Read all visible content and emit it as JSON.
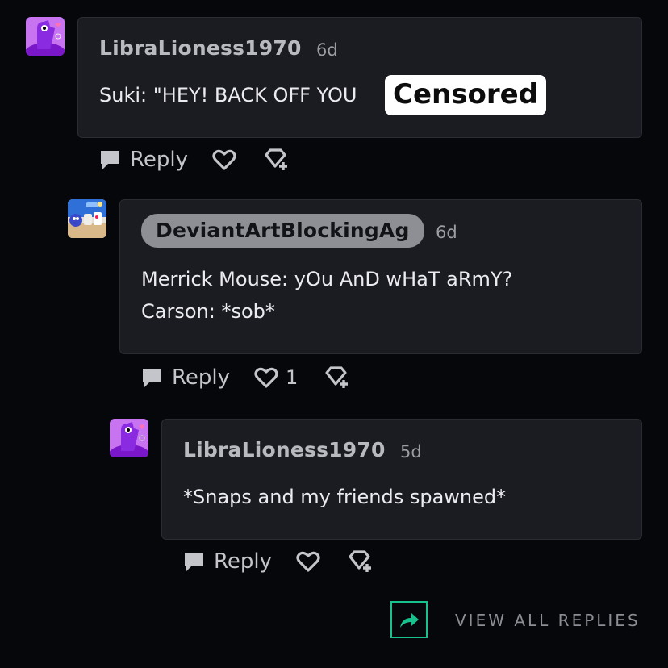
{
  "comments": [
    {
      "username": "LibraLioness1970",
      "time": "6d",
      "text": "Suki: \"HEY! BACK OFF YOU",
      "overlay": "Censored",
      "reply_label": "Reply"
    },
    {
      "username": "DeviantArtBlockingAg",
      "time": "6d",
      "lines": [
        "Merrick Mouse: yOu AnD wHaT aRmY?",
        "Carson: *sob*"
      ],
      "reply_label": "Reply",
      "like_count": "1"
    },
    {
      "username": "LibraLioness1970",
      "time": "5d",
      "text": "*Snaps and my friends spawned*",
      "reply_label": "Reply"
    }
  ],
  "view_all": "VIEW ALL REPLIES",
  "colors": {
    "accent": "#18c28d",
    "card": "#1b1c21",
    "background": "#06070b"
  },
  "icons": [
    "avatar-purple-character",
    "avatar-collage",
    "speech-bubble-icon",
    "heart-icon",
    "gem-plus-icon",
    "share-arrow-icon"
  ]
}
